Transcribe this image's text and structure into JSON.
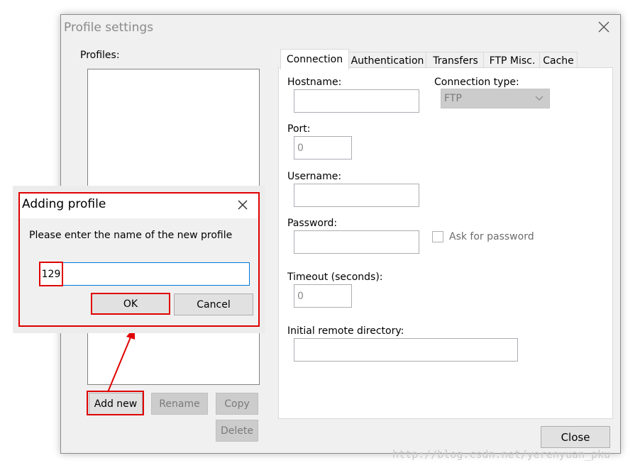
{
  "window": {
    "title": "Profile settings",
    "close_icon": "close-icon"
  },
  "profiles": {
    "label": "Profiles:",
    "buttons": {
      "add_new": "Add new",
      "rename": "Rename",
      "copy": "Copy",
      "delete": "Delete"
    }
  },
  "tabs": [
    "Connection",
    "Authentication",
    "Transfers",
    "FTP Misc.",
    "Cache"
  ],
  "connection": {
    "hostname_label": "Hostname:",
    "hostname_value": "",
    "connection_type_label": "Connection type:",
    "connection_type_value": "FTP",
    "port_label": "Port:",
    "port_value": "0",
    "username_label": "Username:",
    "username_value": "",
    "password_label": "Password:",
    "password_value": "",
    "ask_password_label": "Ask for password",
    "timeout_label": "Timeout (seconds):",
    "timeout_value": "0",
    "remote_dir_label": "Initial remote directory:",
    "remote_dir_value": ""
  },
  "close_button": "Close",
  "dialog": {
    "title": "Adding profile",
    "prompt": "Please enter the name of the new profile",
    "input_value": "129",
    "ok": "OK",
    "cancel": "Cancel"
  },
  "watermark": "http://blog.csdn.net/yerenyuan_pku",
  "colors": {
    "annotation_red": "#e00000",
    "input_focus_border": "#0078d7"
  }
}
